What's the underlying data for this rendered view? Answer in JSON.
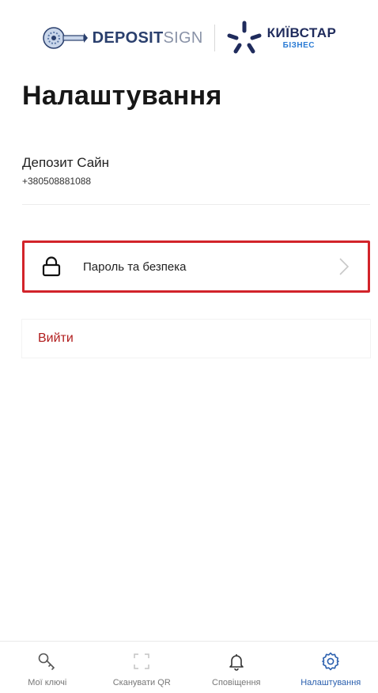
{
  "header": {
    "deposit_strong": "DEPOSIT",
    "deposit_light": "SIGN",
    "kyivstar_name": "КИЇВСТАР",
    "kyivstar_sub": "БІЗНЕС"
  },
  "page": {
    "title": "Налаштування"
  },
  "profile": {
    "name": "Депозит Сайн",
    "phone": "+380508881088"
  },
  "menu": {
    "security_label": "Пароль та безпека",
    "logout_label": "Вийти"
  },
  "tabbar": {
    "items": [
      {
        "label": "Мої ключі",
        "icon": "key-icon"
      },
      {
        "label": "Сканувати QR",
        "icon": "scan-qr-icon"
      },
      {
        "label": "Сповіщення",
        "icon": "bell-icon"
      },
      {
        "label": "Налаштування",
        "icon": "gear-icon"
      }
    ],
    "active_index": 3
  },
  "colors": {
    "accent": "#2a5fae",
    "highlight_border": "#d2232a",
    "logout": "#b11d1d"
  }
}
